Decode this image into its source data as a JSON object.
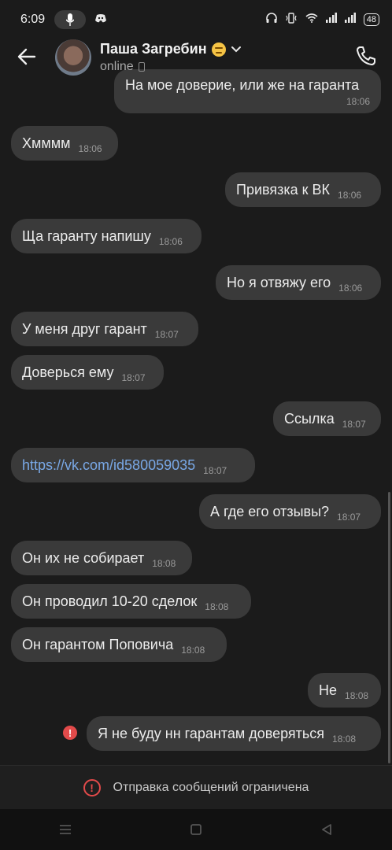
{
  "status_bar": {
    "time": "6:09",
    "battery": "48"
  },
  "header": {
    "contact_name": "Паша Загребин",
    "status": "online"
  },
  "messages": [
    {
      "dir": "out",
      "text": "На мое доверие, или же на гаранта",
      "time": "18:06"
    },
    {
      "dir": "in",
      "text": "Хмммм",
      "time": "18:06"
    },
    {
      "dir": "out",
      "text": "Привязка к ВК",
      "time": "18:06"
    },
    {
      "dir": "in",
      "text": "Ща гаранту напишу",
      "time": "18:06"
    },
    {
      "dir": "out",
      "text": "Но я отвяжу его",
      "time": "18:06"
    },
    {
      "dir": "in",
      "text": "У меня друг гарант",
      "time": "18:07"
    },
    {
      "dir": "in",
      "text": "Доверься ему",
      "time": "18:07"
    },
    {
      "dir": "out",
      "text": "Ссылка",
      "time": "18:07"
    },
    {
      "dir": "in",
      "text": "https://vk.com/id580059035",
      "time": "18:07",
      "link": true
    },
    {
      "dir": "out",
      "text": "А где его отзывы?",
      "time": "18:07"
    },
    {
      "dir": "in",
      "text": "Он их не собирает",
      "time": "18:08"
    },
    {
      "dir": "in",
      "text": "Он проводил 10-20 сделок",
      "time": "18:08"
    },
    {
      "dir": "in",
      "text": "Он гарантом Поповича",
      "time": "18:08"
    },
    {
      "dir": "out",
      "text": "Не",
      "time": "18:08"
    },
    {
      "dir": "out",
      "text": "Я не буду нн гарантам доверяться",
      "time": "18:08",
      "failed": true
    }
  ],
  "error_mark": "!",
  "restricted_notice": "Отправка сообщений ограничена",
  "colors": {
    "bubble": "#3a3a3a",
    "link": "#79a8e6",
    "error": "#e24a4a",
    "background": "#1b1b1b"
  }
}
